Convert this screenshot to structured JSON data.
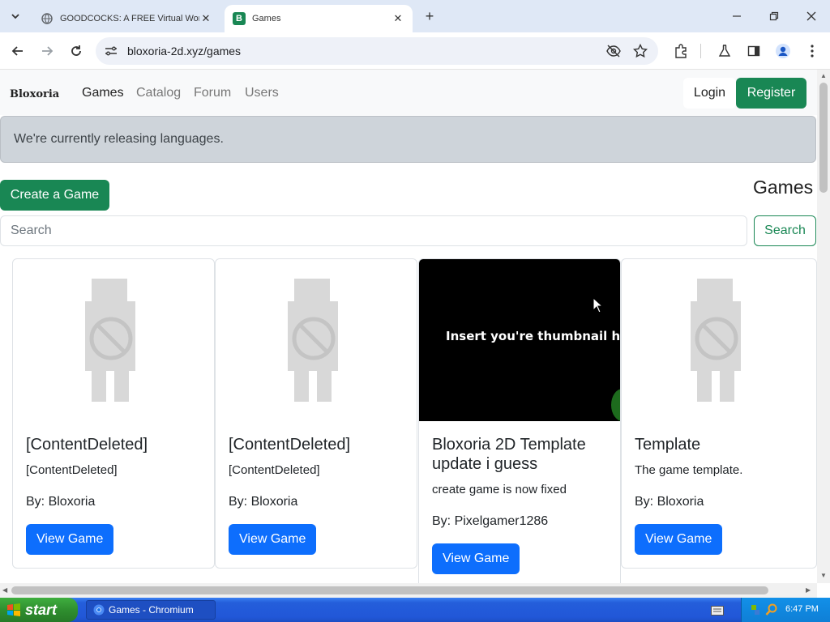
{
  "browser": {
    "tabs": [
      {
        "title": "GOODCOCKS: A FREE Virtual Worl",
        "active": false
      },
      {
        "title": "Games",
        "active": true
      }
    ],
    "url": "bloxoria-2d.xyz/games"
  },
  "navbar": {
    "brand": "Bloxoria",
    "links": [
      "Games",
      "Catalog",
      "Forum",
      "Users"
    ],
    "login_label": "Login",
    "register_label": "Register"
  },
  "alert": {
    "text": "We're currently releasing languages."
  },
  "toolbar": {
    "create_label": "Create a Game",
    "heading": "Games",
    "search_placeholder": "Search",
    "search_button": "Search"
  },
  "cards": [
    {
      "title": "[ContentDeleted]",
      "description": "[ContentDeleted]",
      "author": "By: Bloxoria",
      "button": "View Game",
      "thumbnail": "placeholder"
    },
    {
      "title": "[ContentDeleted]",
      "description": "[ContentDeleted]",
      "author": "By: Bloxoria",
      "button": "View Game",
      "thumbnail": "placeholder"
    },
    {
      "title": "Bloxoria 2D Template update i guess",
      "description": "create game is now fixed",
      "author": "By: Pixelgamer1286",
      "button": "View Game",
      "thumbnail": "image",
      "thumbnail_text": "Insert you're thumbnail here"
    },
    {
      "title": "Template",
      "description": "The game template.",
      "author": "By: Bloxoria",
      "button": "View Game",
      "thumbnail": "placeholder"
    }
  ],
  "taskbar": {
    "start_label": "start",
    "task_label": "Games - Chromium",
    "clock": "6:47 PM"
  },
  "colors": {
    "success": "#198754",
    "primary": "#0d6efd",
    "navbar_bg": "#f8f9fa",
    "alert_bg": "#ced4da"
  }
}
